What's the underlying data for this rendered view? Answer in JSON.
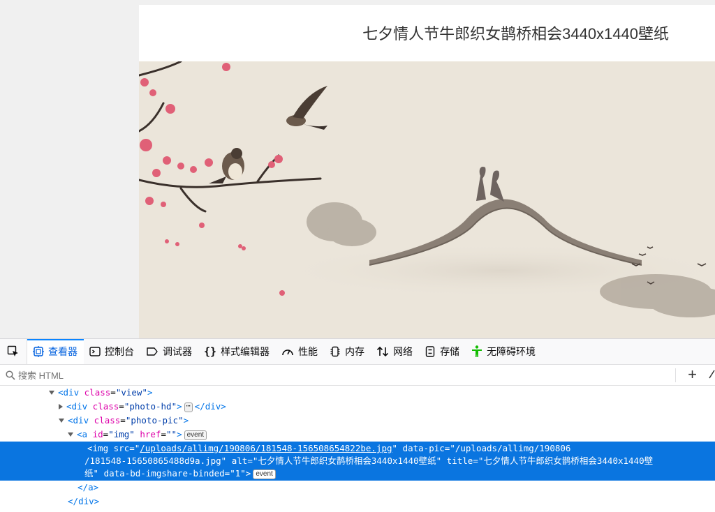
{
  "page": {
    "title": "七夕情人节牛郎织女鹊桥相会3440x1440壁纸",
    "image_alt": "七夕情人节牛郎织女鹊桥相会3440x1440壁纸"
  },
  "devtools": {
    "tabs": [
      {
        "label": "查看器",
        "icon": "inspector-icon",
        "active": true
      },
      {
        "label": "控制台",
        "icon": "console-icon"
      },
      {
        "label": "调试器",
        "icon": "debugger-icon"
      },
      {
        "label": "样式编辑器",
        "icon": "style-editor-icon"
      },
      {
        "label": "性能",
        "icon": "performance-icon"
      },
      {
        "label": "内存",
        "icon": "memory-icon"
      },
      {
        "label": "网络",
        "icon": "network-icon"
      },
      {
        "label": "存储",
        "icon": "storage-icon"
      },
      {
        "label": "无障碍环境",
        "icon": "accessibility-icon"
      }
    ],
    "search_placeholder": "搜索 HTML",
    "tree": {
      "n1": {
        "tag": "div",
        "attr": "class",
        "value": "view"
      },
      "n2": {
        "tag": "div",
        "attr": "class",
        "value": "photo-hd",
        "close": "div"
      },
      "n3": {
        "tag": "div",
        "attr": "class",
        "value": "photo-pic"
      },
      "n4": {
        "tag": "a",
        "attr1": "id",
        "value1": "img",
        "attr2": "href",
        "value2": "",
        "badge": "event"
      },
      "img": {
        "tag": "img",
        "src_attr": "src",
        "src": "/uploads/allimg/190806/181548-156508654822be.jpg",
        "datapic_attr": "data-pic",
        "datapic_part1": "/uploads/allimg/190806",
        "datapic_part2": "/181548-15650865488d9a.jpg",
        "alt_attr": "alt",
        "alt": "七夕情人节牛郎织女鹊桥相会3440x1440壁纸",
        "title_attr": "title",
        "title_part1": "七夕情人节牛郎织女鹊桥相会3440x1440壁",
        "title_part2": "纸",
        "binded_attr": "data-bd-imgshare-binded",
        "binded": "1",
        "badge": "event"
      },
      "close_a": "a",
      "close_div": "div"
    }
  },
  "colors": {
    "accent": "#0a84ff",
    "selection": "#0a75e0",
    "tag": "#0074e8",
    "attr": "#dd00a9",
    "value": "#003eaa"
  }
}
